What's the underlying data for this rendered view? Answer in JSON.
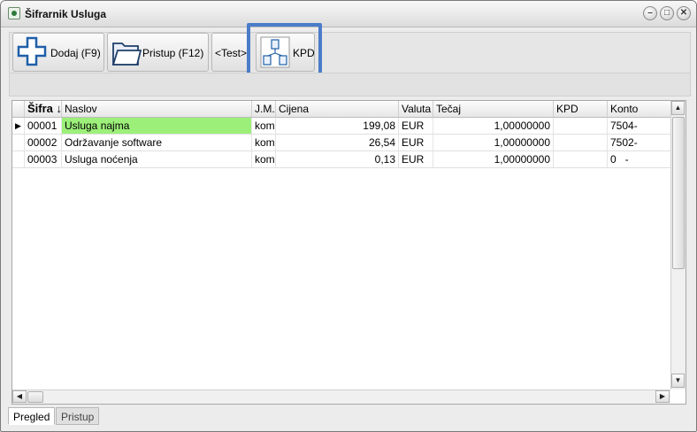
{
  "window": {
    "title": "Šifrarnik Usluga"
  },
  "toolbar": {
    "add_label": "Dodaj (F9)",
    "open_label": "Pristup (F12)",
    "test_label": "<Test>",
    "kpd_label": "KPD"
  },
  "grid": {
    "columns": [
      "Šifra",
      "Naslov",
      "J.M.",
      "Cijena",
      "Valuta",
      "Tečaj",
      "KPD",
      "Konto"
    ],
    "sort_indicator": "↓",
    "rows": [
      {
        "sifra": "00001",
        "naslov": "Usluga najma",
        "jm": "kom",
        "cijena": "199,08",
        "valuta": "EUR",
        "tecaj": "1,00000000",
        "kpd": "",
        "konto": "7504-"
      },
      {
        "sifra": "00002",
        "naslov": "Održavanje software",
        "jm": "kom",
        "cijena": "26,54",
        "valuta": "EUR",
        "tecaj": "1,00000000",
        "kpd": "",
        "konto": "7502-"
      },
      {
        "sifra": "00003",
        "naslov": "Usluga noćenja",
        "jm": "kom",
        "cijena": "0,13",
        "valuta": "EUR",
        "tecaj": "1,00000000",
        "kpd": "",
        "konto": "0   -"
      }
    ],
    "selected_row": 0,
    "selected_color": "#9cf07a"
  },
  "tabs": [
    "Pregled",
    "Pristup"
  ],
  "active_tab": "Pregled",
  "colors": {
    "highlight": "#4a7cc9",
    "icon_blue": "#1f5fa8"
  }
}
